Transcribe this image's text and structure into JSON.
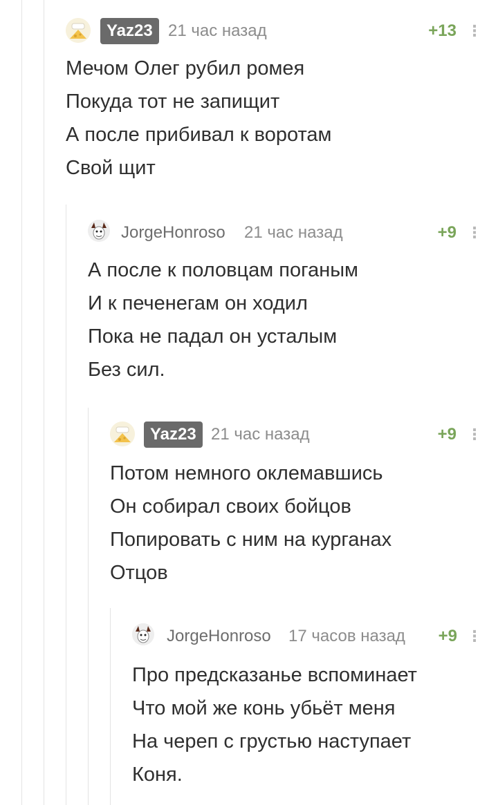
{
  "comments": [
    {
      "username": "Yaz23",
      "time": "21 час назад",
      "rating": "+13",
      "more_icon": "⋮",
      "avatar": "cheese-avatar",
      "lines": [
        "Мечом Олег рубил ромея",
        "Покуда тот не запищит",
        "А после прибивал к воротам",
        "Свой щит"
      ]
    },
    {
      "username": "JorgeHonroso",
      "time": "21 час назад",
      "rating": "+9",
      "more_icon": "⋮",
      "avatar": "face-avatar",
      "lines": [
        "А после к половцам поганым",
        "И к печенегам он ходил",
        "Пока не падал он усталым",
        "Без сил."
      ]
    },
    {
      "username": "Yaz23",
      "time": "21 час назад",
      "rating": "+9",
      "more_icon": "⋮",
      "avatar": "cheese-avatar",
      "lines": [
        "Потом немного оклемавшись",
        "Он собирал своих бойцов",
        "Попировать с ним на курганах",
        "Отцов"
      ]
    },
    {
      "username": "JorgeHonroso",
      "time": "17 часов назад",
      "rating": "+9",
      "more_icon": "⋮",
      "avatar": "face-avatar",
      "lines": [
        "Про предсказанье вспоминает",
        "Что мой же конь убьёт меня",
        "На череп с грустью наступает",
        "Коня."
      ]
    }
  ],
  "colors": {
    "rating": "#7aa55a",
    "badge_bg": "#6a6a6a",
    "text": "#2f2f2f",
    "meta": "#8c8c8c",
    "thread_line": "#e3e3e3"
  }
}
